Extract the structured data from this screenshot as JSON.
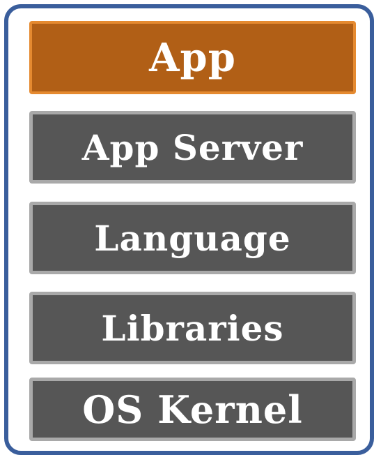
{
  "layers": [
    {
      "label": "App",
      "color": "#b15f16"
    },
    {
      "label": "App Server",
      "color": "#565656"
    },
    {
      "label": "Language",
      "color": "#565656"
    },
    {
      "label": "Libraries",
      "color": "#565656"
    },
    {
      "label": "OS Kernel",
      "color": "#565656"
    }
  ],
  "colors": {
    "frame_border": "#3a5e9c",
    "app_fill": "#b15f16",
    "app_border": "#e58a30",
    "layer_fill": "#565656",
    "layer_border": "#a9a9a9",
    "text": "#ffffff"
  }
}
